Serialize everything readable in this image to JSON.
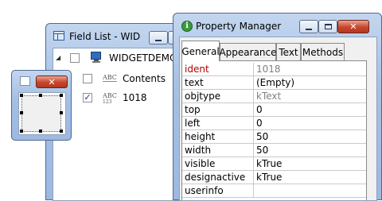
{
  "field_list": {
    "title": "Field List - WID",
    "root_label": "WIDGETDEMO",
    "items": [
      {
        "label": "Contents",
        "icon": "abc-text-icon",
        "checked": false
      },
      {
        "label": "1018",
        "icon": "abc-number-icon",
        "checked": true
      }
    ]
  },
  "property_manager": {
    "title": "Property Manager",
    "tabs": [
      "General",
      "Appearance",
      "Text",
      "Methods"
    ],
    "rows": [
      {
        "key": "ident",
        "value": "1018"
      },
      {
        "key": "text",
        "value": "(Empty)"
      },
      {
        "key": "objtype",
        "value": "kText"
      },
      {
        "key": "top",
        "value": "0"
      },
      {
        "key": "left",
        "value": "0"
      },
      {
        "key": "height",
        "value": "50"
      },
      {
        "key": "width",
        "value": "50"
      },
      {
        "key": "visible",
        "value": "kTrue"
      },
      {
        "key": "designactive",
        "value": "kTrue"
      },
      {
        "key": "userinfo",
        "value": ""
      }
    ]
  },
  "colors": {
    "accent": "#3399ff",
    "readonly_key": "#b00000",
    "readonly_value": "#808080"
  }
}
